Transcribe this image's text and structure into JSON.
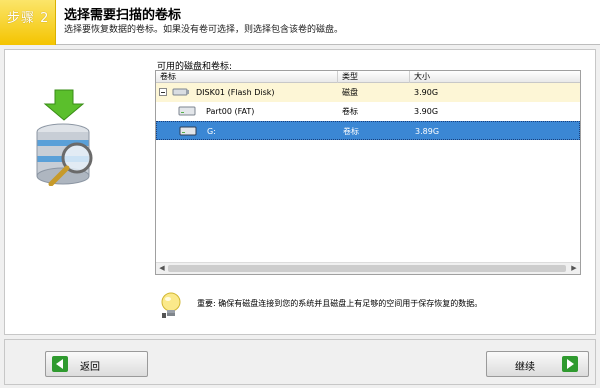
{
  "header": {
    "step_label": "步骤 2",
    "title": "选择需要扫描的卷标",
    "subtitle": "选择要恢复数据的卷标。如果没有卷可选择，则选择包含该卷的磁盘。"
  },
  "volume_list": {
    "label": "可用的磁盘和卷标:",
    "columns": [
      "卷标",
      "类型",
      "大小"
    ],
    "rows": [
      {
        "name": "DISK01 (Flash Disk)",
        "type": "磁盘",
        "size": "3.90G",
        "icon": "flash-disk-icon",
        "expanded": true
      },
      {
        "name": "Part00 (FAT)",
        "type": "卷标",
        "size": "3.90G",
        "icon": "drive-icon"
      },
      {
        "name": "G:",
        "type": "卷标",
        "size": "3.89G",
        "icon": "drive-icon",
        "selected": true
      }
    ]
  },
  "note": {
    "text": "重要: 确保有磁盘连接到您的系统并且磁盘上有足够的空间用于保存恢复的数据。"
  },
  "footer": {
    "back_label": "返回",
    "next_label": "继续"
  },
  "colors": {
    "accent_yellow": "#f4c400",
    "selection_blue": "#3b87d4",
    "arrow_green": "#3aa33a"
  }
}
